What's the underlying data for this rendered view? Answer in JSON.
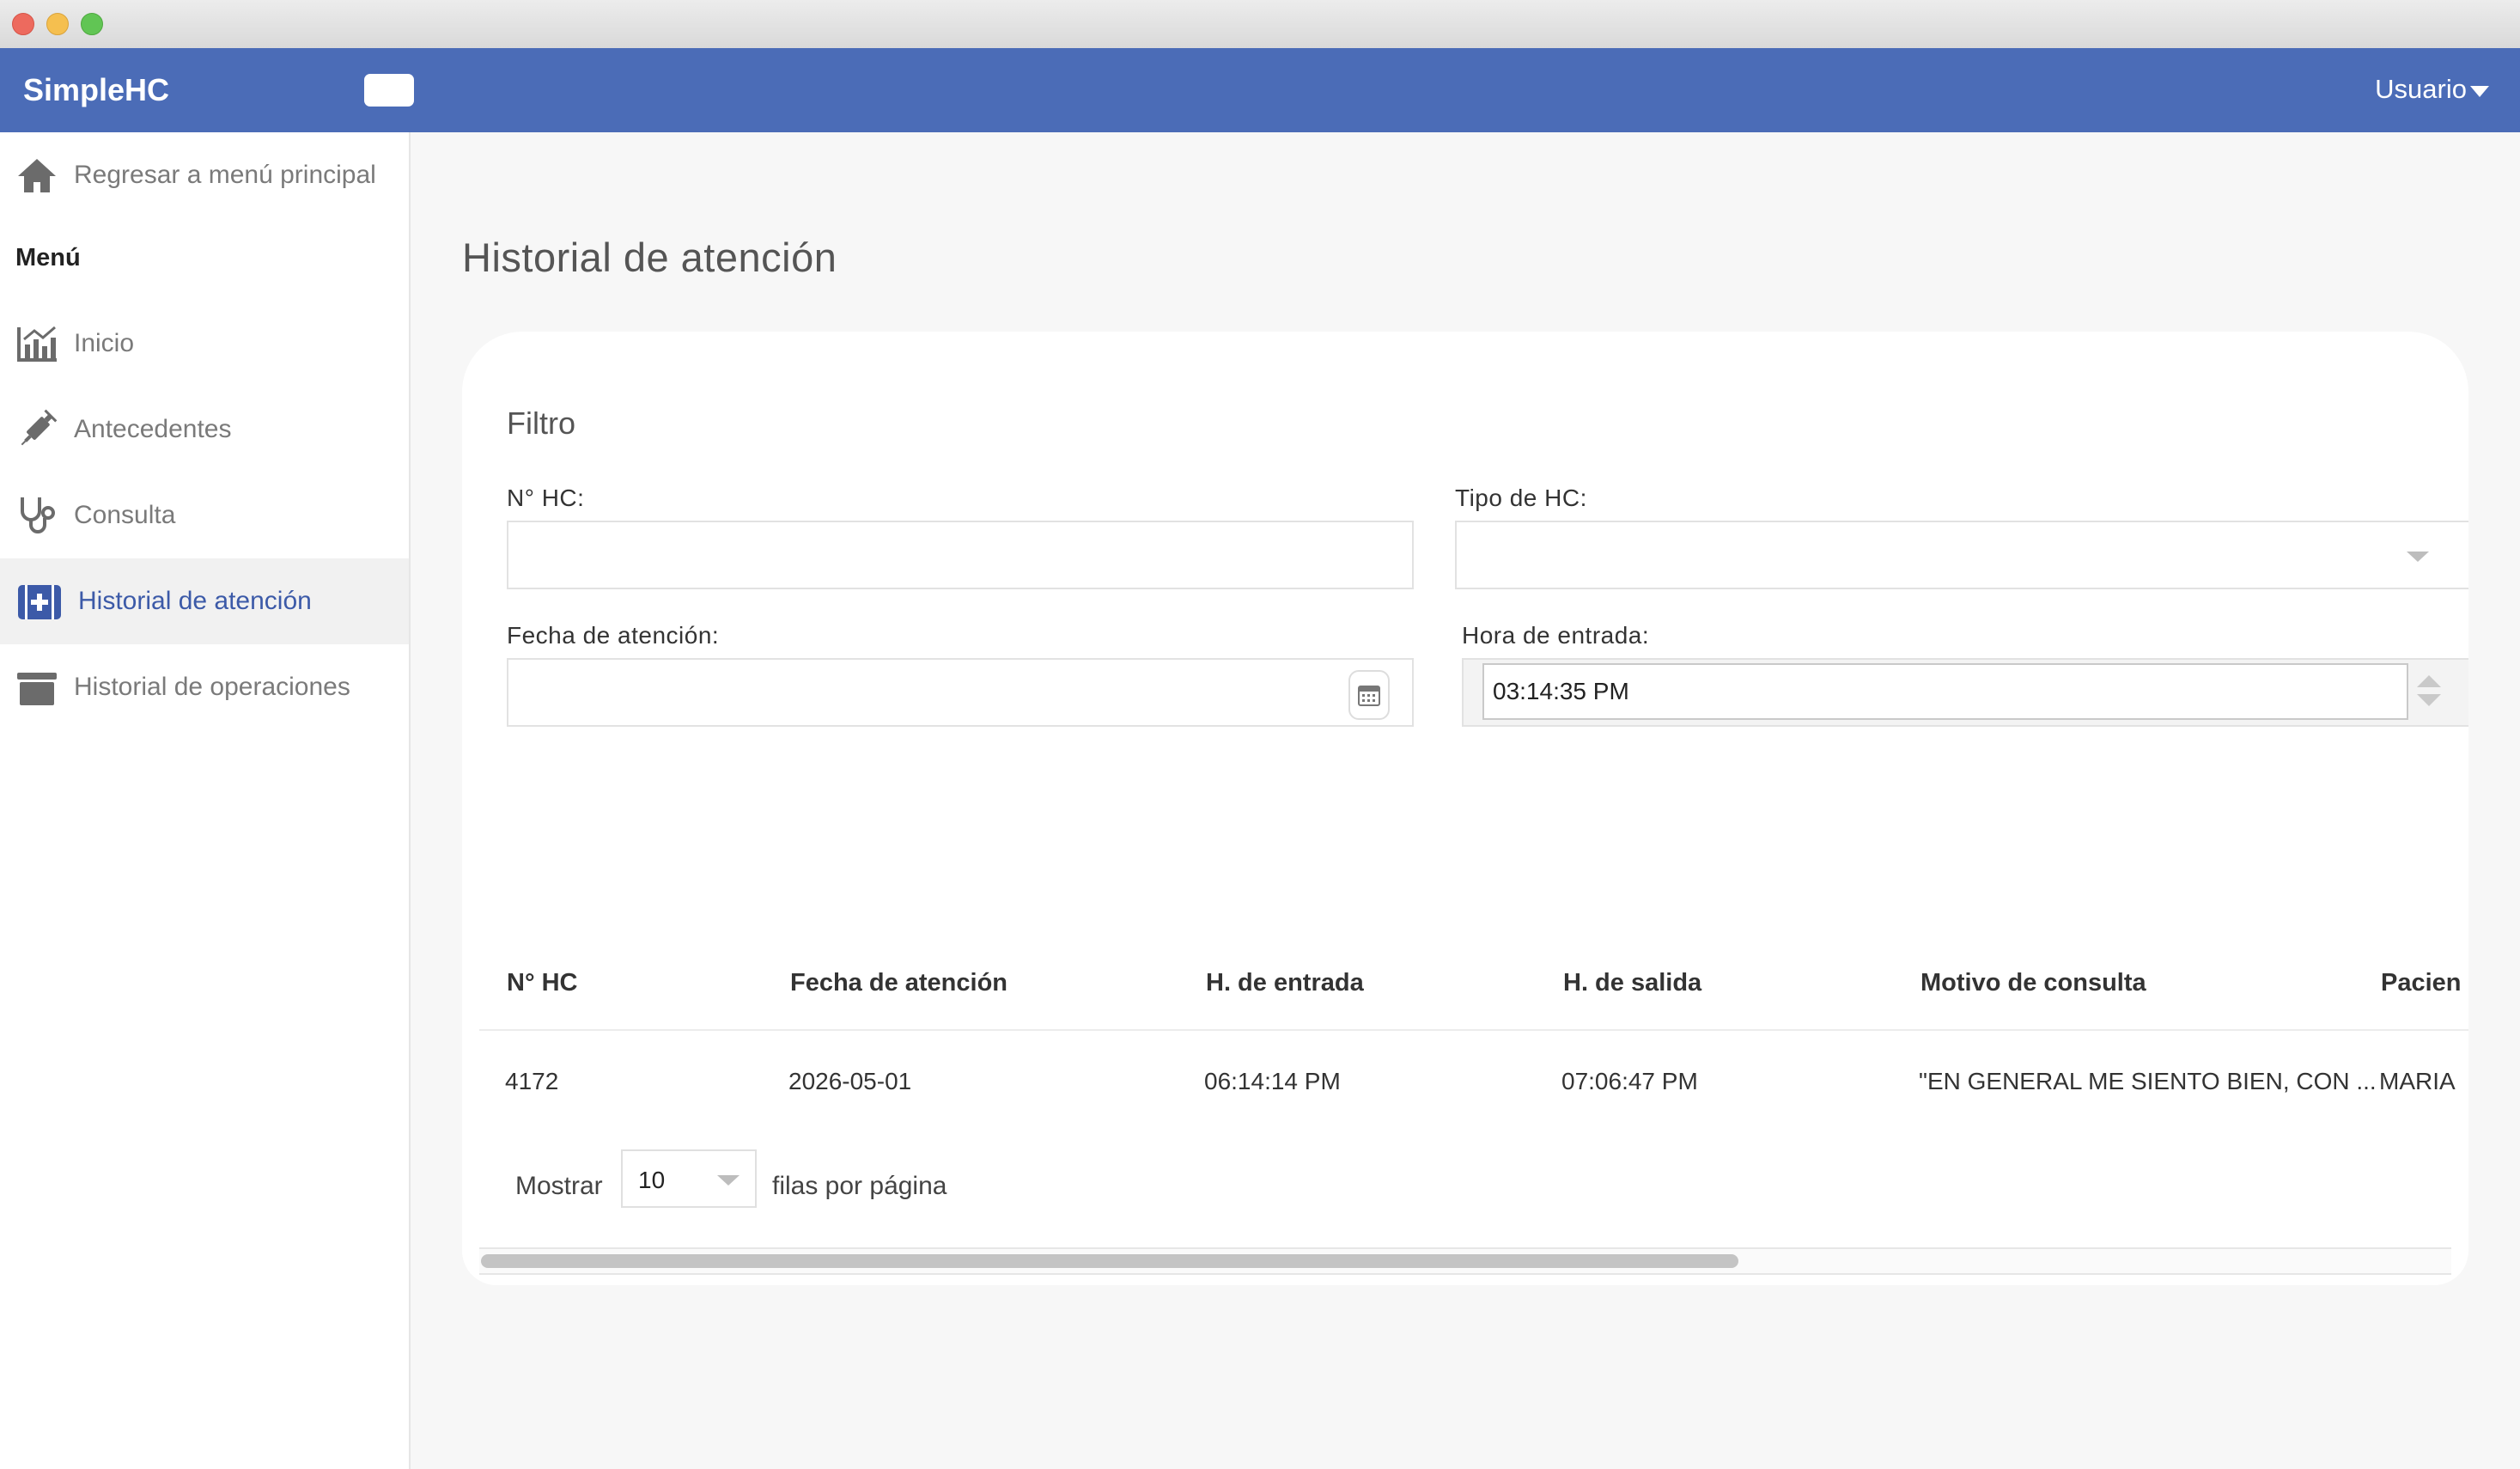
{
  "app": {
    "brand": "SimpleHC",
    "user_label": "Usuario"
  },
  "sidebar": {
    "back_label": "Regresar a menú principal",
    "menu_heading": "Menú",
    "items": [
      {
        "label": "Inicio",
        "icon": "chart-icon"
      },
      {
        "label": "Antecedentes",
        "icon": "syringe-icon"
      },
      {
        "label": "Consulta",
        "icon": "stethoscope-icon"
      },
      {
        "label": "Historial de atención",
        "icon": "medical-kit-icon",
        "active": true
      },
      {
        "label": "Historial de operaciones",
        "icon": "archive-icon"
      }
    ]
  },
  "main": {
    "title": "Historial de atención",
    "filter": {
      "title": "Filtro",
      "hc_number_label": "N° HC:",
      "hc_number_value": "",
      "hc_type_label": "Tipo de HC:",
      "hc_type_value": "",
      "date_label": "Fecha de atención:",
      "date_value": "",
      "entry_time_label": "Hora de entrada:",
      "entry_time_value": "03:14:35 PM"
    },
    "table": {
      "headers": [
        "N° HC",
        "Fecha de atención",
        "H. de entrada",
        "H. de salida",
        "Motivo de consulta",
        "Pacien"
      ],
      "rows": [
        [
          "4172",
          "2026-05-01",
          "06:14:14 PM",
          "07:06:47 PM",
          "\"EN GENERAL ME SIENTO BIEN, CON ...",
          "MARIA"
        ]
      ]
    },
    "pager": {
      "show_label": "Mostrar",
      "rows_value": "10",
      "per_page_label": "filas por página"
    }
  },
  "colors": {
    "navbar": "#4b6cb7",
    "active_text": "#3c5aa8"
  }
}
